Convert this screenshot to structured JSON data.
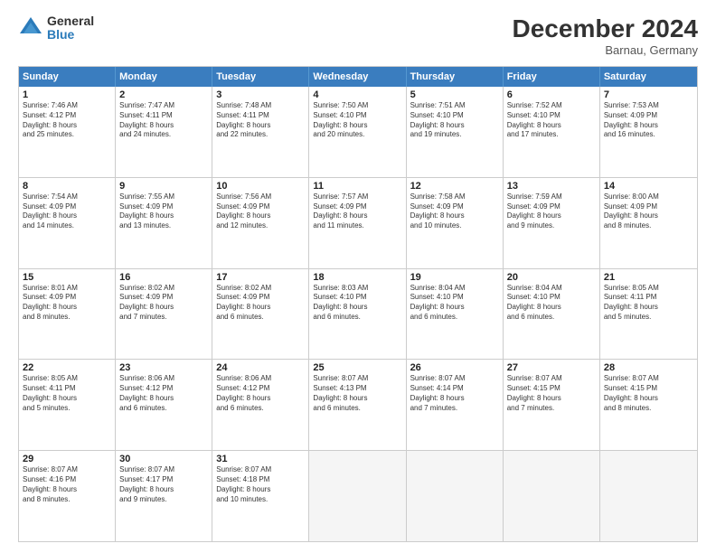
{
  "logo": {
    "general": "General",
    "blue": "Blue"
  },
  "title": "December 2024",
  "location": "Barnau, Germany",
  "header": {
    "days": [
      "Sunday",
      "Monday",
      "Tuesday",
      "Wednesday",
      "Thursday",
      "Friday",
      "Saturday"
    ]
  },
  "weeks": [
    [
      {
        "day": "1",
        "lines": [
          "Sunrise: 7:46 AM",
          "Sunset: 4:12 PM",
          "Daylight: 8 hours",
          "and 25 minutes."
        ]
      },
      {
        "day": "2",
        "lines": [
          "Sunrise: 7:47 AM",
          "Sunset: 4:11 PM",
          "Daylight: 8 hours",
          "and 24 minutes."
        ]
      },
      {
        "day": "3",
        "lines": [
          "Sunrise: 7:48 AM",
          "Sunset: 4:11 PM",
          "Daylight: 8 hours",
          "and 22 minutes."
        ]
      },
      {
        "day": "4",
        "lines": [
          "Sunrise: 7:50 AM",
          "Sunset: 4:10 PM",
          "Daylight: 8 hours",
          "and 20 minutes."
        ]
      },
      {
        "day": "5",
        "lines": [
          "Sunrise: 7:51 AM",
          "Sunset: 4:10 PM",
          "Daylight: 8 hours",
          "and 19 minutes."
        ]
      },
      {
        "day": "6",
        "lines": [
          "Sunrise: 7:52 AM",
          "Sunset: 4:10 PM",
          "Daylight: 8 hours",
          "and 17 minutes."
        ]
      },
      {
        "day": "7",
        "lines": [
          "Sunrise: 7:53 AM",
          "Sunset: 4:09 PM",
          "Daylight: 8 hours",
          "and 16 minutes."
        ]
      }
    ],
    [
      {
        "day": "8",
        "lines": [
          "Sunrise: 7:54 AM",
          "Sunset: 4:09 PM",
          "Daylight: 8 hours",
          "and 14 minutes."
        ]
      },
      {
        "day": "9",
        "lines": [
          "Sunrise: 7:55 AM",
          "Sunset: 4:09 PM",
          "Daylight: 8 hours",
          "and 13 minutes."
        ]
      },
      {
        "day": "10",
        "lines": [
          "Sunrise: 7:56 AM",
          "Sunset: 4:09 PM",
          "Daylight: 8 hours",
          "and 12 minutes."
        ]
      },
      {
        "day": "11",
        "lines": [
          "Sunrise: 7:57 AM",
          "Sunset: 4:09 PM",
          "Daylight: 8 hours",
          "and 11 minutes."
        ]
      },
      {
        "day": "12",
        "lines": [
          "Sunrise: 7:58 AM",
          "Sunset: 4:09 PM",
          "Daylight: 8 hours",
          "and 10 minutes."
        ]
      },
      {
        "day": "13",
        "lines": [
          "Sunrise: 7:59 AM",
          "Sunset: 4:09 PM",
          "Daylight: 8 hours",
          "and 9 minutes."
        ]
      },
      {
        "day": "14",
        "lines": [
          "Sunrise: 8:00 AM",
          "Sunset: 4:09 PM",
          "Daylight: 8 hours",
          "and 8 minutes."
        ]
      }
    ],
    [
      {
        "day": "15",
        "lines": [
          "Sunrise: 8:01 AM",
          "Sunset: 4:09 PM",
          "Daylight: 8 hours",
          "and 8 minutes."
        ]
      },
      {
        "day": "16",
        "lines": [
          "Sunrise: 8:02 AM",
          "Sunset: 4:09 PM",
          "Daylight: 8 hours",
          "and 7 minutes."
        ]
      },
      {
        "day": "17",
        "lines": [
          "Sunrise: 8:02 AM",
          "Sunset: 4:09 PM",
          "Daylight: 8 hours",
          "and 6 minutes."
        ]
      },
      {
        "day": "18",
        "lines": [
          "Sunrise: 8:03 AM",
          "Sunset: 4:10 PM",
          "Daylight: 8 hours",
          "and 6 minutes."
        ]
      },
      {
        "day": "19",
        "lines": [
          "Sunrise: 8:04 AM",
          "Sunset: 4:10 PM",
          "Daylight: 8 hours",
          "and 6 minutes."
        ]
      },
      {
        "day": "20",
        "lines": [
          "Sunrise: 8:04 AM",
          "Sunset: 4:10 PM",
          "Daylight: 8 hours",
          "and 6 minutes."
        ]
      },
      {
        "day": "21",
        "lines": [
          "Sunrise: 8:05 AM",
          "Sunset: 4:11 PM",
          "Daylight: 8 hours",
          "and 5 minutes."
        ]
      }
    ],
    [
      {
        "day": "22",
        "lines": [
          "Sunrise: 8:05 AM",
          "Sunset: 4:11 PM",
          "Daylight: 8 hours",
          "and 5 minutes."
        ]
      },
      {
        "day": "23",
        "lines": [
          "Sunrise: 8:06 AM",
          "Sunset: 4:12 PM",
          "Daylight: 8 hours",
          "and 6 minutes."
        ]
      },
      {
        "day": "24",
        "lines": [
          "Sunrise: 8:06 AM",
          "Sunset: 4:12 PM",
          "Daylight: 8 hours",
          "and 6 minutes."
        ]
      },
      {
        "day": "25",
        "lines": [
          "Sunrise: 8:07 AM",
          "Sunset: 4:13 PM",
          "Daylight: 8 hours",
          "and 6 minutes."
        ]
      },
      {
        "day": "26",
        "lines": [
          "Sunrise: 8:07 AM",
          "Sunset: 4:14 PM",
          "Daylight: 8 hours",
          "and 7 minutes."
        ]
      },
      {
        "day": "27",
        "lines": [
          "Sunrise: 8:07 AM",
          "Sunset: 4:15 PM",
          "Daylight: 8 hours",
          "and 7 minutes."
        ]
      },
      {
        "day": "28",
        "lines": [
          "Sunrise: 8:07 AM",
          "Sunset: 4:15 PM",
          "Daylight: 8 hours",
          "and 8 minutes."
        ]
      }
    ],
    [
      {
        "day": "29",
        "lines": [
          "Sunrise: 8:07 AM",
          "Sunset: 4:16 PM",
          "Daylight: 8 hours",
          "and 8 minutes."
        ]
      },
      {
        "day": "30",
        "lines": [
          "Sunrise: 8:07 AM",
          "Sunset: 4:17 PM",
          "Daylight: 8 hours",
          "and 9 minutes."
        ]
      },
      {
        "day": "31",
        "lines": [
          "Sunrise: 8:07 AM",
          "Sunset: 4:18 PM",
          "Daylight: 8 hours",
          "and 10 minutes."
        ]
      },
      {
        "day": "",
        "lines": []
      },
      {
        "day": "",
        "lines": []
      },
      {
        "day": "",
        "lines": []
      },
      {
        "day": "",
        "lines": []
      }
    ]
  ]
}
